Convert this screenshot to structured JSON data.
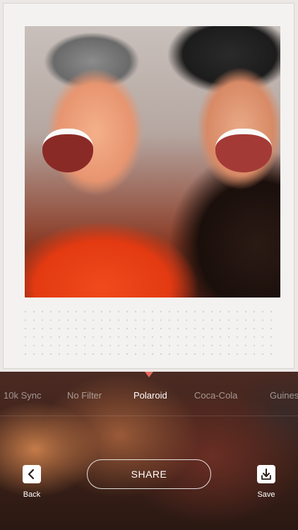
{
  "filters": {
    "items": [
      "10k Sync",
      "No Filter",
      "Polaroid",
      "Coca-Cola",
      "Guiness"
    ],
    "selected": "Polaroid"
  },
  "actions": {
    "back_label": "Back",
    "share_label": "SHARE",
    "save_label": "Save"
  },
  "colors": {
    "selected_pointer": "#e26a5a",
    "polaroid_frame": "#f3f2f0"
  },
  "icons": {
    "back": "chevron-left-icon",
    "save": "download-icon"
  }
}
